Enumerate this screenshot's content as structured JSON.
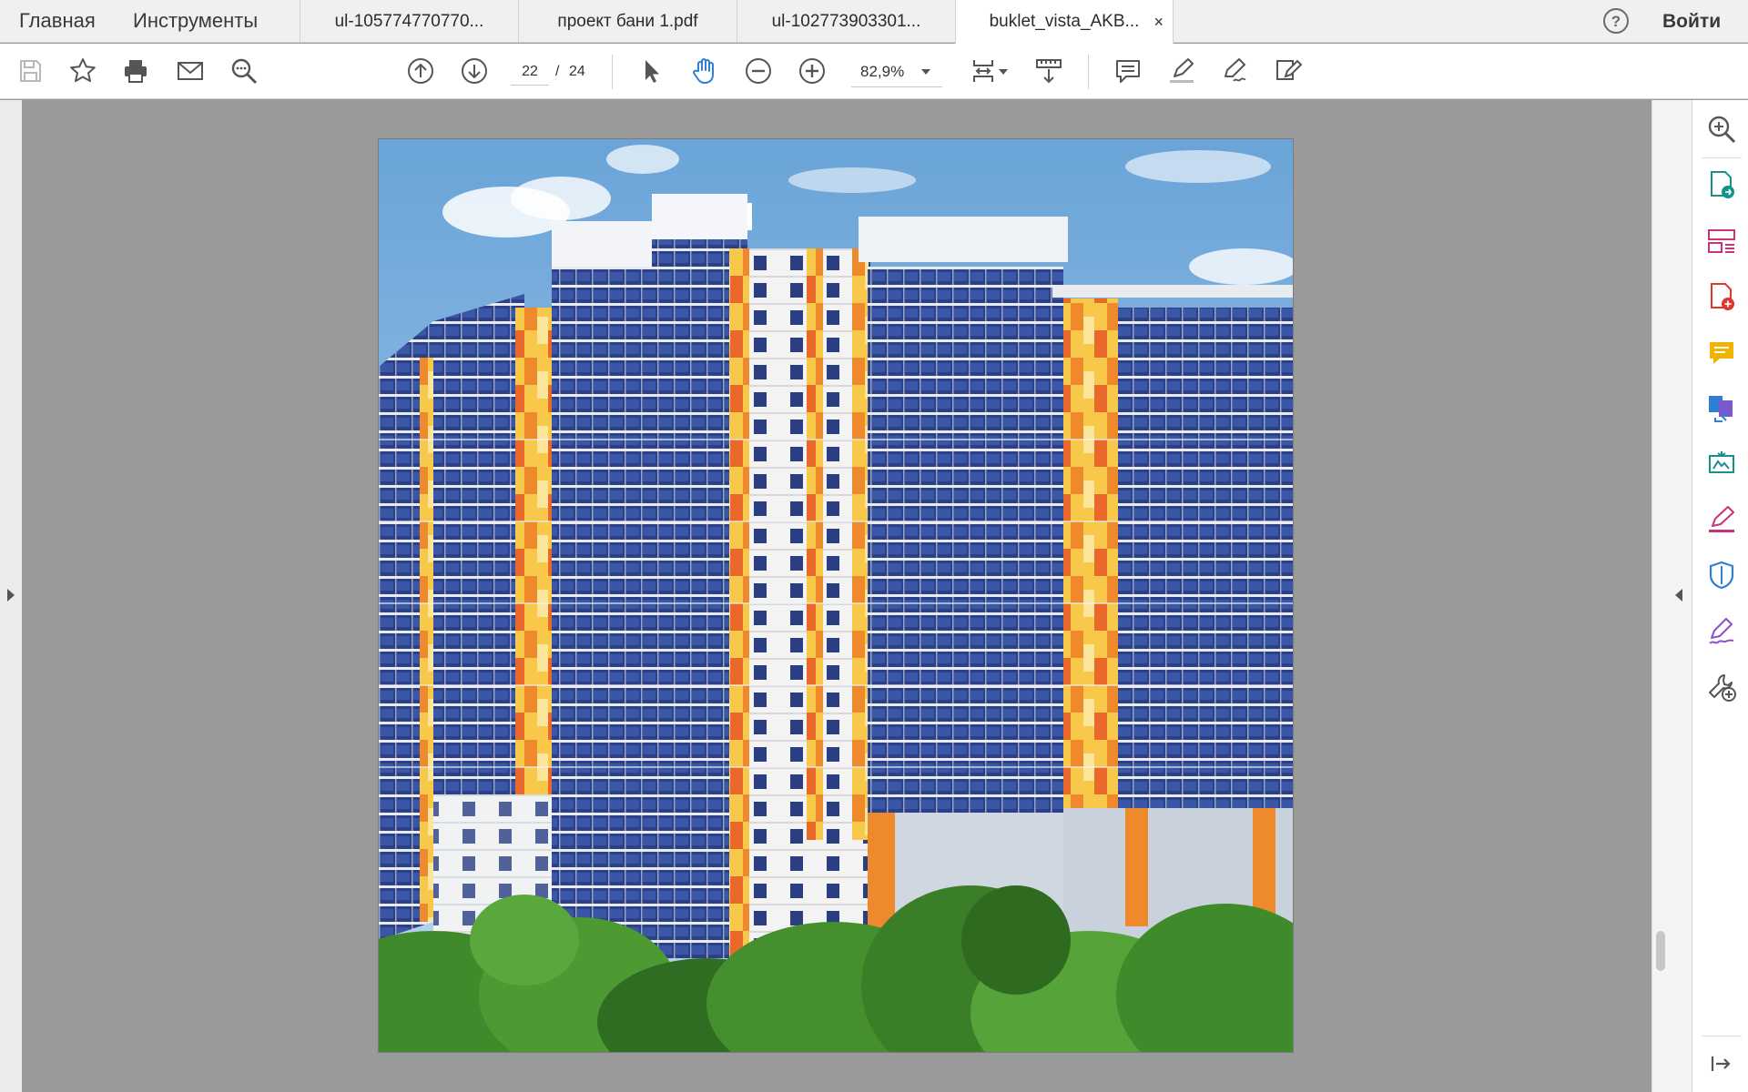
{
  "nav": {
    "home": "Главная",
    "tools": "Инструменты"
  },
  "tabs": [
    {
      "label": "ul-105774770770..."
    },
    {
      "label": "проект бани 1.pdf"
    },
    {
      "label": "ul-102773903301..."
    },
    {
      "label": "buklet_vista_AKB...",
      "active": true,
      "close": "×"
    }
  ],
  "header": {
    "help": "?",
    "login": "Войти"
  },
  "toolbar": {
    "current_page": "22",
    "page_separator": "/",
    "total_pages": "24",
    "zoom": "82,9%"
  },
  "icons": {
    "left_tools": [
      "save-icon",
      "star-icon",
      "print-icon",
      "mail-icon",
      "find-icon"
    ],
    "nav_tools": [
      "page-up-icon",
      "page-down-icon"
    ],
    "view_tools": [
      "select-cursor-icon",
      "hand-tool-icon",
      "zoom-out-icon",
      "zoom-in-icon"
    ],
    "right_pane": [
      "search-zoom-icon",
      "export-pdf-icon",
      "organize-pages-icon",
      "create-pdf-icon",
      "comment-icon",
      "combine-files-icon",
      "edit-pdf-icon",
      "fill-sign-icon",
      "protect-icon",
      "sign-icon",
      "more-tools-icon"
    ]
  },
  "colors": {
    "accent_blue": "#2f7fd4",
    "red": "#e0362b",
    "magenta": "#c8327a",
    "yellow": "#f0b400",
    "purple": "#8a52cc",
    "teal": "#17918b"
  }
}
